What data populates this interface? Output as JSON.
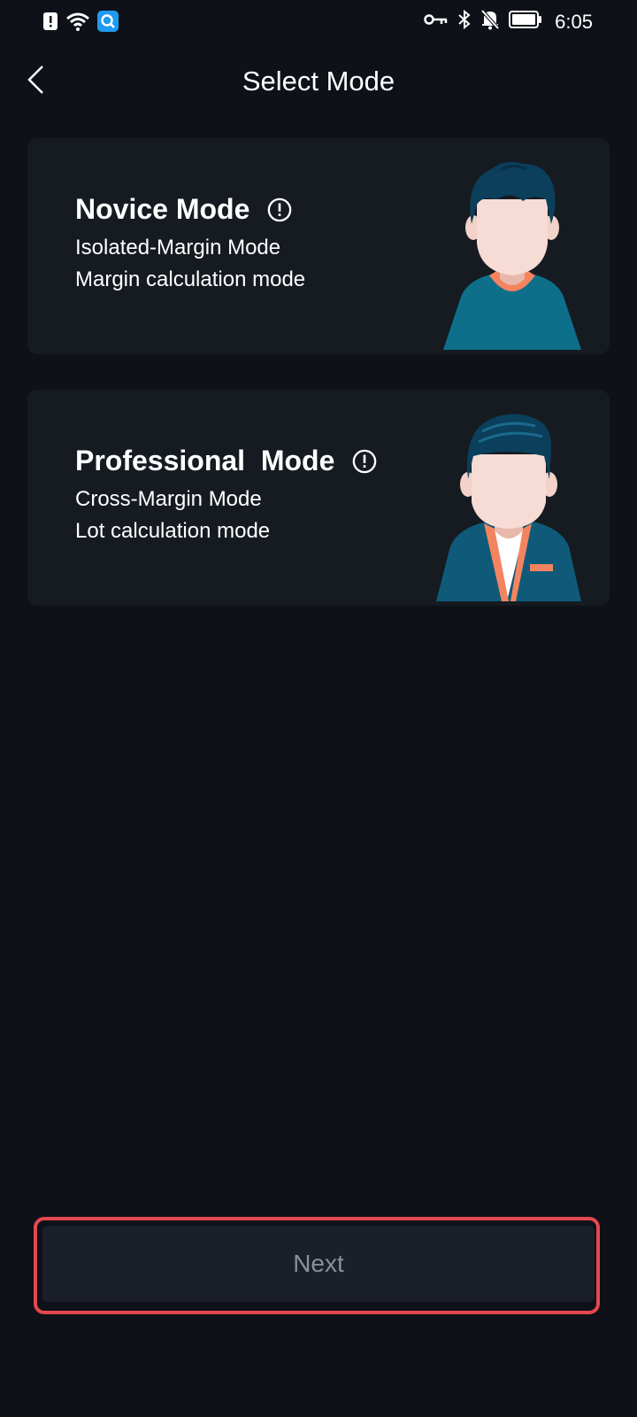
{
  "status_bar": {
    "time": "6:05",
    "icons": [
      "alert-icon",
      "wifi-icon",
      "search-app-icon",
      "key-icon",
      "bluetooth-icon",
      "bell-off-icon",
      "battery-icon"
    ]
  },
  "header": {
    "title": "Select Mode",
    "back_icon": "chevron-left-icon"
  },
  "modes": [
    {
      "title": "Novice Mode",
      "line1": "Isolated-Margin Mode",
      "line2": "Margin calculation mode",
      "avatar_icon": "novice-avatar-icon"
    },
    {
      "title": "Professional  Mode",
      "line1": "Cross-Margin Mode",
      "line2": "Lot calculation mode",
      "avatar_icon": "professional-avatar-icon"
    }
  ],
  "footer": {
    "next_label": "Next"
  },
  "colors": {
    "background": "#0e1118",
    "card": "#161b22",
    "button": "#1a1f29",
    "button_text": "#8a8f99",
    "highlight": "#e5484d",
    "teal": "#0e7490",
    "orange": "#f4845f"
  }
}
